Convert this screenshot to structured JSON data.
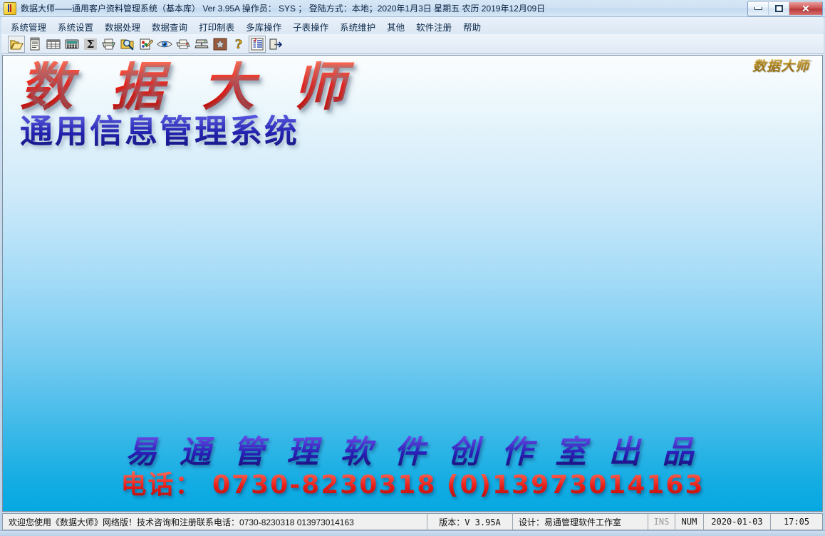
{
  "window": {
    "title": "数据大师——通用客户资料管理系统（基本库）  Ver 3.95A  操作员： SYS  ； 登陆方式：本地；2020年1月3日  星期五  农历 2019年12月09日",
    "app_icon": "app-logo-icon",
    "controls": {
      "minimize": "minimize-icon",
      "maximize": "maximize-icon",
      "close": "✕"
    }
  },
  "menubar": {
    "items": [
      {
        "label": "系统管理",
        "name": "menu-system-manage"
      },
      {
        "label": "系统设置",
        "name": "menu-system-settings"
      },
      {
        "label": "数据处理",
        "name": "menu-data-process"
      },
      {
        "label": "数据查询",
        "name": "menu-data-query"
      },
      {
        "label": "打印制表",
        "name": "menu-print-table"
      },
      {
        "label": "多库操作",
        "name": "menu-multi-db"
      },
      {
        "label": "子表操作",
        "name": "menu-subtable"
      },
      {
        "label": "系统维护",
        "name": "menu-system-maintain"
      },
      {
        "label": "其他",
        "name": "menu-other"
      },
      {
        "label": "软件注册",
        "name": "menu-register"
      },
      {
        "label": "帮助",
        "name": "menu-help"
      }
    ]
  },
  "toolbar": {
    "buttons": [
      {
        "icon": "open-folder-icon",
        "framed": true
      },
      {
        "icon": "document-list-icon",
        "framed": false
      },
      {
        "icon": "grid-table-icon",
        "framed": false
      },
      {
        "icon": "calculator-icon",
        "framed": false
      },
      {
        "icon": "sigma-sum-icon",
        "framed": false
      },
      {
        "icon": "printer-icon",
        "framed": false
      },
      {
        "icon": "search-zoom-icon",
        "framed": false
      },
      {
        "icon": "edit-pen-chart-icon",
        "framed": false
      },
      {
        "icon": "eye-preview-icon",
        "framed": false
      },
      {
        "icon": "print-color-icon",
        "framed": false
      },
      {
        "icon": "network-server-icon",
        "framed": false
      },
      {
        "icon": "puzzle-star-icon",
        "framed": false
      },
      {
        "icon": "help-question-icon",
        "framed": false
      },
      {
        "icon": "report-list-icon",
        "framed": true
      },
      {
        "icon": "exit-door-icon",
        "framed": false
      }
    ]
  },
  "client": {
    "headline_main": "数 据 大 师",
    "headline_sub": "通用信息管理系统",
    "corner_logo": "数据大师",
    "studio_line": "易 通 管 理 软 件 创 作 室  出 品",
    "phone_line": "电话： 0730-8230318  (0)13973014163"
  },
  "statusbar": {
    "message": "欢迎您使用《数据大师》网络版！技术咨询和注册联系电话：0730-8230318   013973014163",
    "version": "版本：V 3.95A",
    "designer": "设计：易通管理软件工作室",
    "ins": "INS",
    "num": "NUM",
    "date": "2020-01-03",
    "time": "17:05"
  },
  "colors": {
    "headline_red": "#e8201c",
    "headline_blue": "#2b2bb5",
    "canvas_top": "#fbfdfe",
    "canvas_bottom": "#06a8e2",
    "close_button": "#c04a4a",
    "gold_logo": "#b8860b"
  }
}
